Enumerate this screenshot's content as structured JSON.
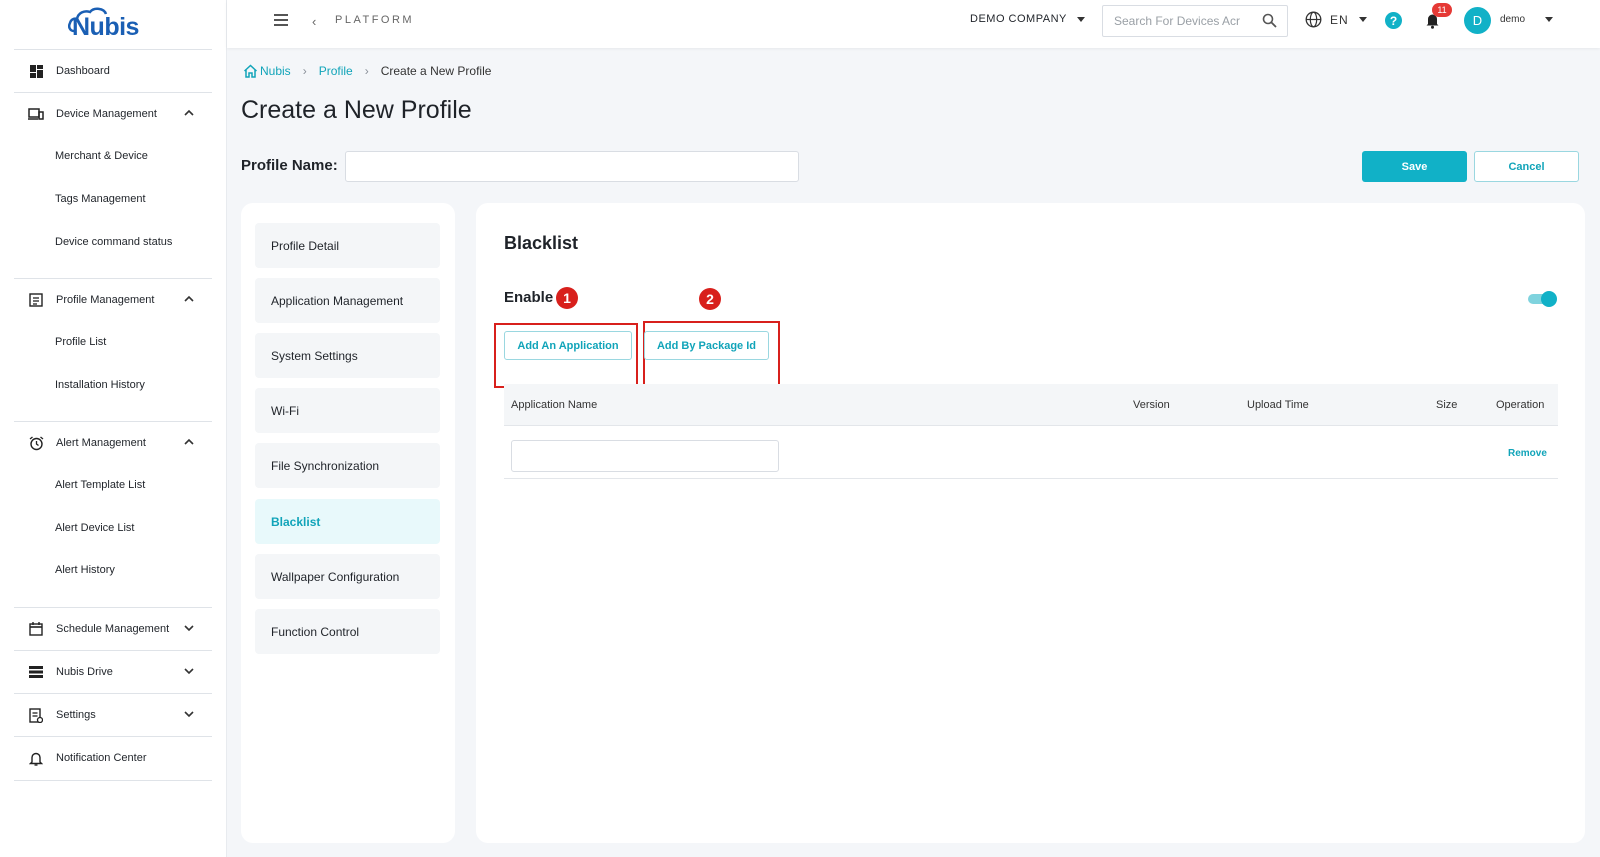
{
  "brand": {
    "logo_text": "Nubis",
    "accent": "#11b1c7",
    "marker_red": "#d8201c"
  },
  "sidebar": {
    "items": [
      {
        "label": "Dashboard",
        "icon": "dashboard-icon"
      },
      {
        "label": "Device Management",
        "icon": "devices-icon",
        "expanded": true,
        "children": [
          "Merchant & Device",
          "Tags Management",
          "Device command status"
        ]
      },
      {
        "label": "Profile Management",
        "icon": "profile-icon",
        "expanded": true,
        "children": [
          "Profile List",
          "Installation History"
        ]
      },
      {
        "label": "Alert Management",
        "icon": "alarm-clock-icon",
        "expanded": true,
        "children": [
          "Alert Template List",
          "Alert Device List",
          "Alert History"
        ]
      },
      {
        "label": "Schedule Management",
        "icon": "calendar-icon",
        "expanded": false
      },
      {
        "label": "Nubis Drive",
        "icon": "drive-list-icon",
        "expanded": false
      },
      {
        "label": "Settings",
        "icon": "settings-doc-icon",
        "expanded": false
      },
      {
        "label": "Notification Center",
        "icon": "bell-outline-icon"
      }
    ]
  },
  "topbar": {
    "platform_label": "PLATFORM",
    "company": "DEMO COMPANY",
    "search_placeholder": "Search For Devices Acr",
    "language": "EN",
    "help": "?",
    "notification_count": "11",
    "avatar_initial": "D",
    "username": "demo"
  },
  "breadcrumb": {
    "home": "Nubis",
    "profile": "Profile",
    "current": "Create a New Profile"
  },
  "page": {
    "title": "Create a New Profile",
    "profile_name_label": "Profile Name:",
    "profile_name_value": "",
    "save_label": "Save",
    "cancel_label": "Cancel"
  },
  "menu": {
    "items": [
      "Profile Detail",
      "Application Management",
      "System Settings",
      "Wi-Fi",
      "File Synchronization",
      "Blacklist",
      "Wallpaper Configuration",
      "Function Control"
    ],
    "active": "Blacklist"
  },
  "blacklist": {
    "title": "Blacklist",
    "enable_label": "Enable",
    "enabled": true,
    "markers": [
      "1",
      "2"
    ],
    "add_app_label": "Add An Application",
    "add_package_label": "Add By Package Id",
    "columns": [
      "Application Name",
      "Version",
      "Upload Time",
      "Size",
      "Operation"
    ],
    "rows": [
      {
        "app_name_value": "",
        "operation": "Remove"
      }
    ]
  }
}
